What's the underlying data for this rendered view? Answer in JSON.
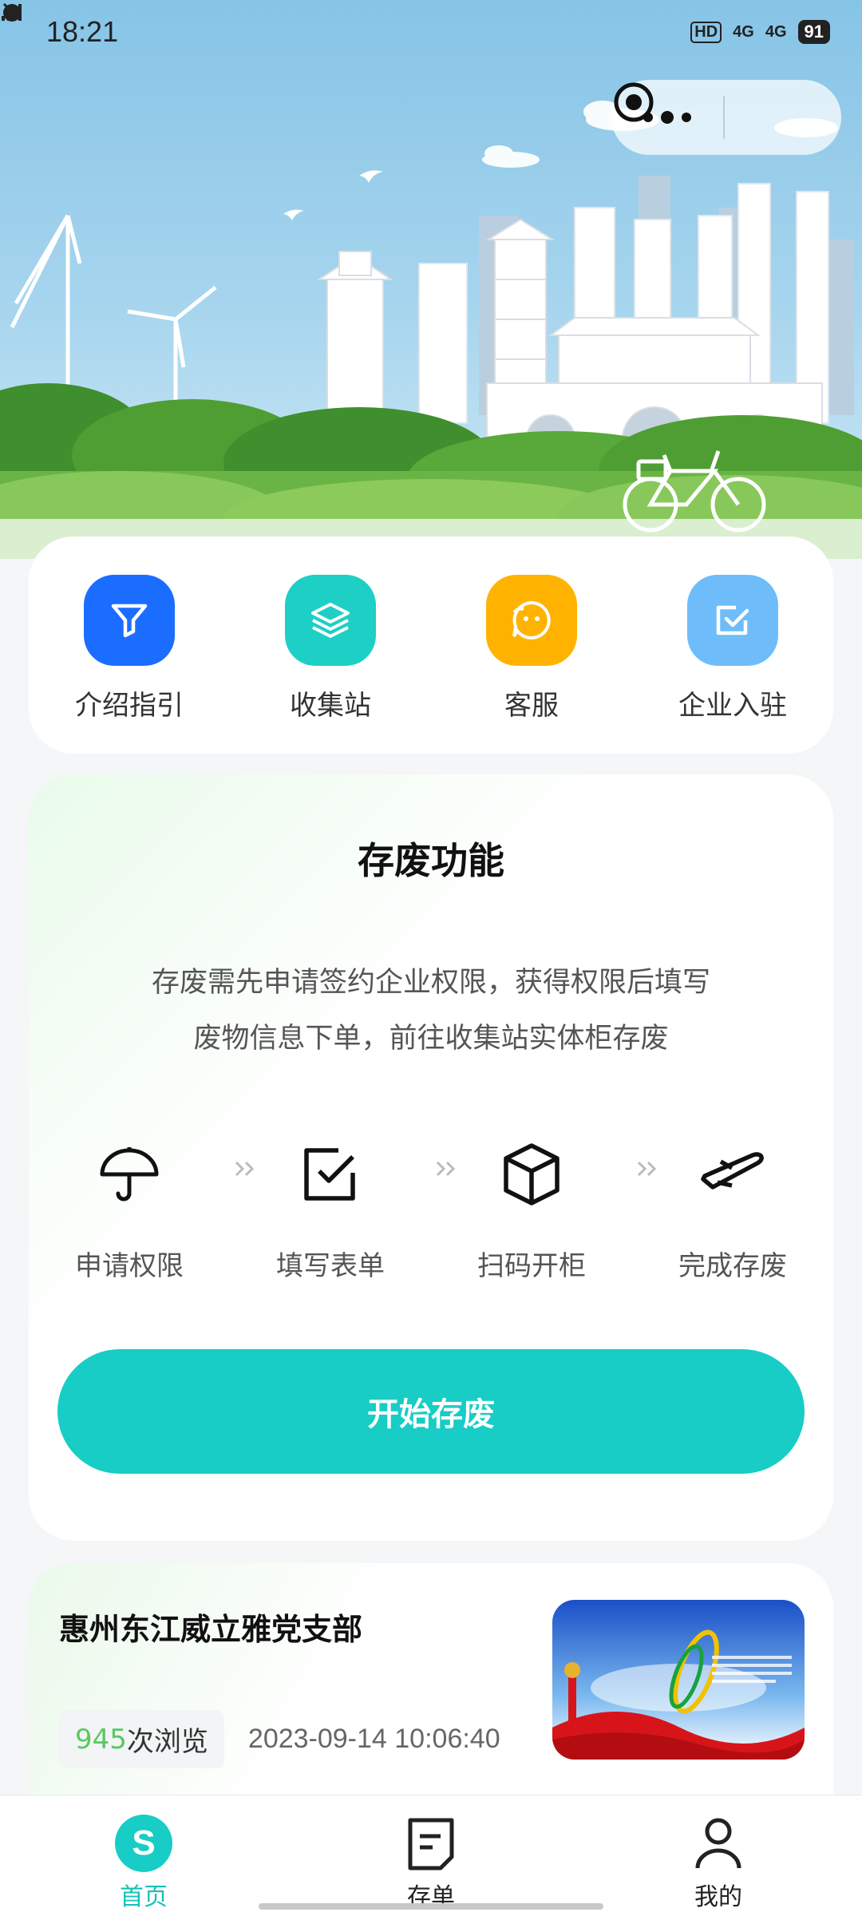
{
  "status_bar": {
    "time": "18:21",
    "icons": [
      "alarm-icon",
      "mute-icon",
      "hd-icon",
      "signal-4g-icon",
      "signal-4g-icon"
    ],
    "hd_text": "HD",
    "net1": "4G",
    "net2": "4G",
    "battery": "91"
  },
  "capsule": {
    "more_icon": "more-dots-icon",
    "close_icon": "target-close-icon"
  },
  "quick_menu": [
    {
      "label": "介绍指引",
      "icon": "filter-icon",
      "color": "#1a6dff"
    },
    {
      "label": "收集站",
      "icon": "layers-icon",
      "color": "#1ecfc5"
    },
    {
      "label": "客服",
      "icon": "smile-chat-icon",
      "color": "#ffb300"
    },
    {
      "label": "企业入驻",
      "icon": "checkbox-icon",
      "color": "#6ebdfa"
    }
  ],
  "function_card": {
    "title": "存废功能",
    "desc_line1": "存废需先申请签约企业权限，获得权限后填写",
    "desc_line2": "废物信息下单，前往收集站实体柜存废",
    "steps": [
      {
        "label": "申请权限",
        "icon": "umbrella-icon"
      },
      {
        "label": "填写表单",
        "icon": "edit-check-icon"
      },
      {
        "label": "扫码开柜",
        "icon": "box-icon"
      },
      {
        "label": "完成存废",
        "icon": "plane-icon"
      }
    ],
    "start_button": "开始存废",
    "accent": "#17cdc6"
  },
  "news": {
    "title": "惠州东江威立雅党支部",
    "views_count": "945",
    "views_suffix": "次浏览",
    "date": "2023-09-14 10:06:40",
    "thumb_icon": "party-banner-image"
  },
  "tabbar": {
    "tabs": [
      {
        "label": "首页",
        "icon": "home-s-icon",
        "active": true
      },
      {
        "label": "存单",
        "icon": "document-icon",
        "active": false
      },
      {
        "label": "我的",
        "icon": "user-icon",
        "active": false
      }
    ],
    "active_color": "#17c0b8"
  }
}
